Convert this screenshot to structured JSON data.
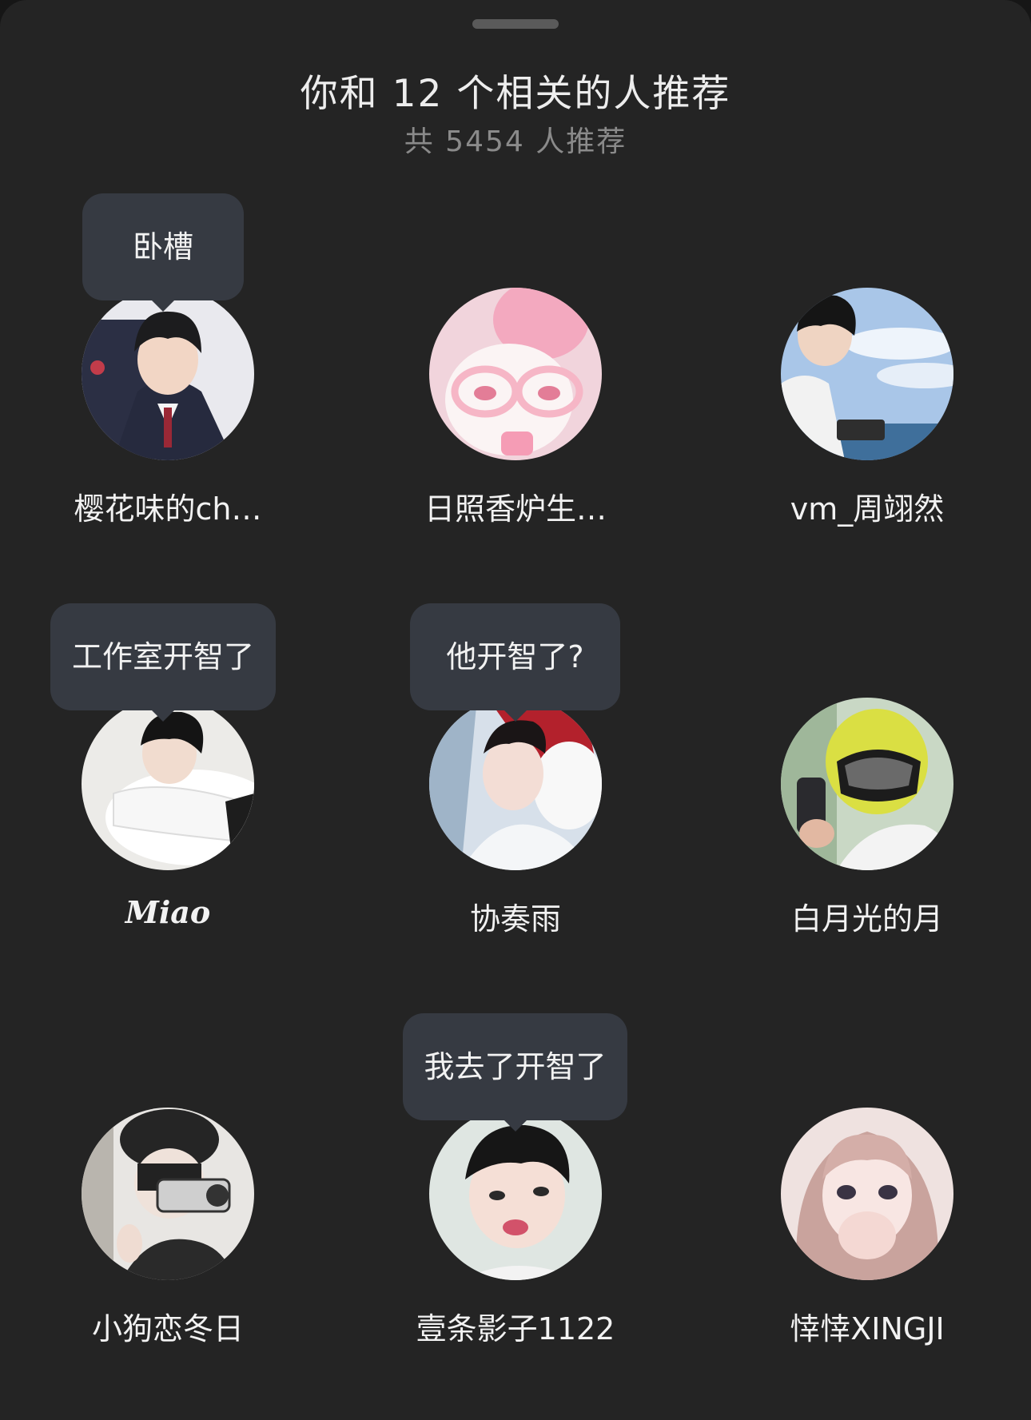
{
  "header": {
    "title": "你和 12 个相关的人推荐",
    "subtitle": "共 5454 人推荐"
  },
  "people": [
    {
      "name": "樱花味的ch…",
      "comment": "卧槽"
    },
    {
      "name": "日照香炉生…",
      "comment": ""
    },
    {
      "name": "vm_周翊然",
      "comment": ""
    },
    {
      "name": "𝑴𝒊𝒂𝒐",
      "comment": "工作室开智了"
    },
    {
      "name": "协奏雨",
      "comment": "他开智了?"
    },
    {
      "name": "白月光的月",
      "comment": ""
    },
    {
      "name": "小狗恋冬日",
      "comment": ""
    },
    {
      "name": "壹条影子1122",
      "comment": "我去了开智了"
    },
    {
      "name": "悻悻XINGJI",
      "comment": ""
    }
  ],
  "colors": {
    "background": "#242424",
    "bubble": "#363a42",
    "title": "#ededed",
    "subtitle": "#8a8a8a"
  }
}
